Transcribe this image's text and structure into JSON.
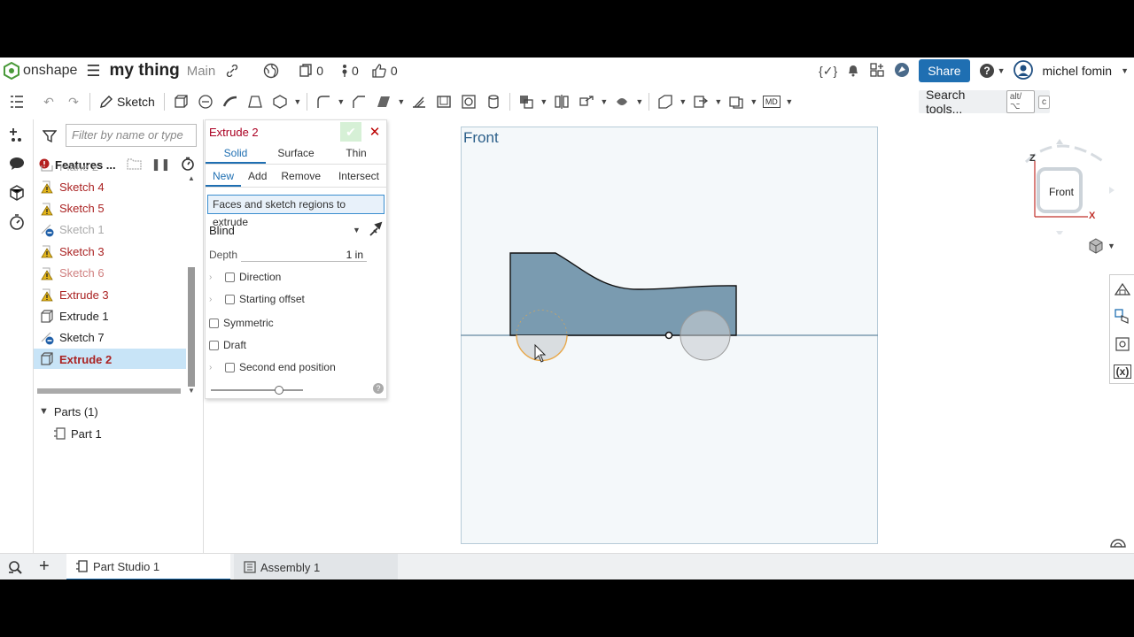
{
  "topbar": {
    "logo_text": "onshape",
    "doc_title": "my thing",
    "branch": "Main",
    "copies_count": "0",
    "versions_count": "0",
    "likes_count": "0",
    "share_label": "Share",
    "user_name": "michel fomin"
  },
  "toolbar": {
    "sketch_label": "Sketch",
    "search_label": "Search tools...",
    "search_kbd_1": "alt/⌥",
    "search_kbd_2": "c"
  },
  "features": {
    "filter_placeholder": "Filter by name or type",
    "header_title": "Features ...",
    "items": [
      {
        "label": "Plane 2",
        "state": "grey",
        "icon": "plane"
      },
      {
        "label": "Sketch 4",
        "state": "red",
        "icon": "warning"
      },
      {
        "label": "Sketch 5",
        "state": "red",
        "icon": "warning"
      },
      {
        "label": "Sketch 1",
        "state": "grey",
        "icon": "sketch-minus"
      },
      {
        "label": "Sketch 3",
        "state": "red",
        "icon": "warning"
      },
      {
        "label": "Sketch 6",
        "state": "grey-red",
        "icon": "warning"
      },
      {
        "label": "Extrude 3",
        "state": "red",
        "icon": "extrude-warning"
      },
      {
        "label": "Extrude 1",
        "state": "dark",
        "icon": "extrude"
      },
      {
        "label": "Sketch 7",
        "state": "dark",
        "icon": "sketch-minus"
      },
      {
        "label": "Extrude 2",
        "state": "selected",
        "icon": "extrude"
      }
    ],
    "parts_label": "Parts (1)",
    "part_label": "Part 1"
  },
  "dialog": {
    "title": "Extrude 2",
    "tabs": [
      "Solid",
      "Surface",
      "Thin"
    ],
    "active_tab": "Solid",
    "ops": [
      "New",
      "Add",
      "Remove",
      "Intersect"
    ],
    "active_op": "New",
    "selection_text": "Faces and sketch regions to extrude",
    "end_type": "Blind",
    "depth_label": "Depth",
    "depth_value": "1 in",
    "direction_label": "Direction",
    "starting_offset_label": "Starting offset",
    "symmetric_label": "Symmetric",
    "draft_label": "Draft",
    "second_end_label": "Second end position"
  },
  "viewport": {
    "plane_label": "Front",
    "cube_label": "Front",
    "axis_z": "Z",
    "axis_x": "X"
  },
  "bottom": {
    "tab1": "Part Studio 1",
    "tab2": "Assembly 1"
  },
  "colors": {
    "accent": "#1f6fb2",
    "region_fill": "#7a9bb0",
    "warning": "#e3b51b",
    "error_text": "#a22222"
  }
}
